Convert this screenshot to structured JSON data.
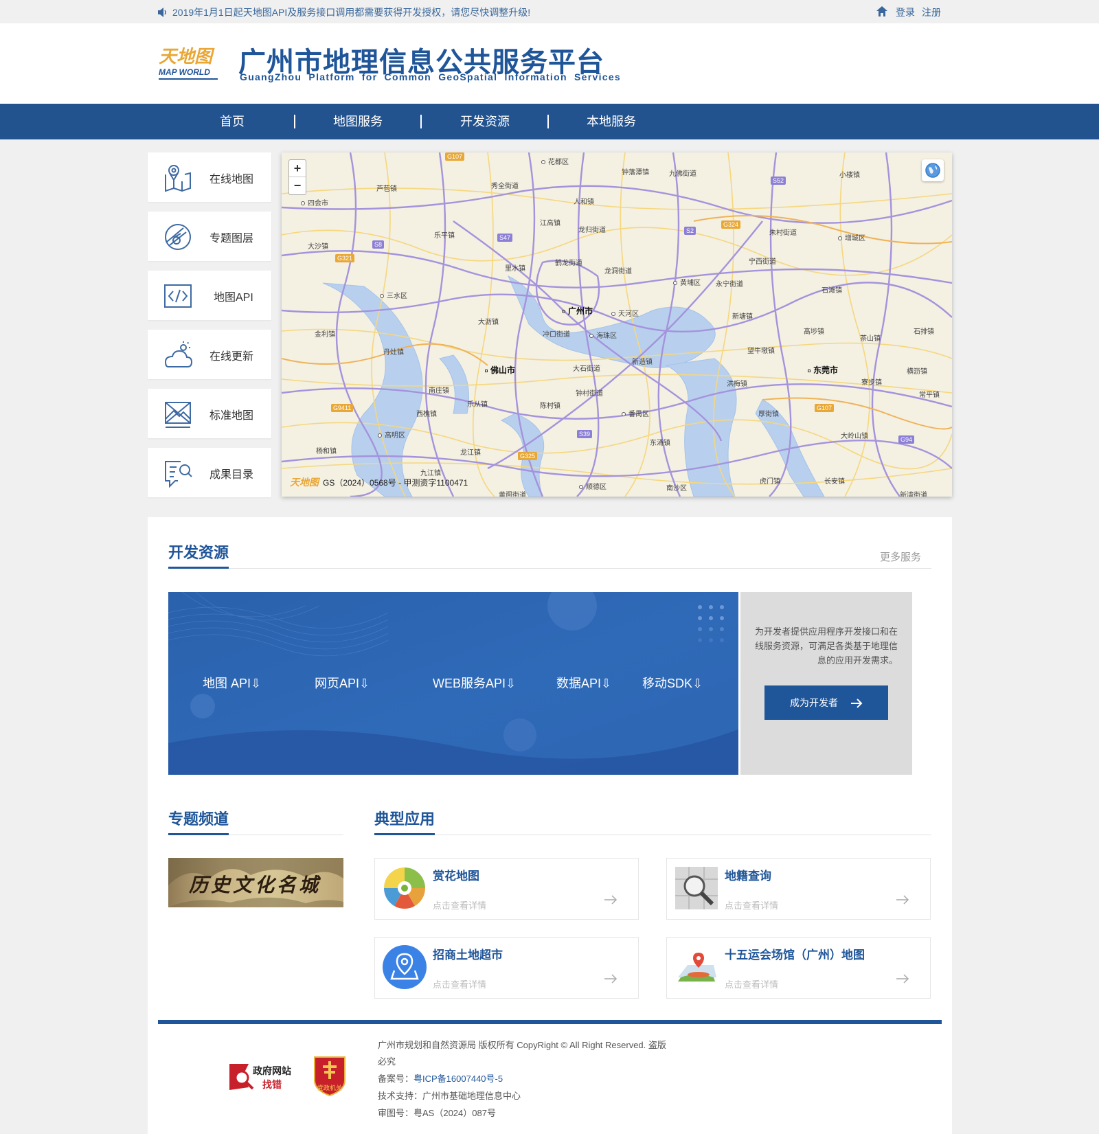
{
  "topbar": {
    "notice": "2019年1月1日起天地图API及服务接口调用都需要获得开发授权，请您尽快调整升级!",
    "login": "登录",
    "register": "注册"
  },
  "header": {
    "logo_text_top": "天地图",
    "logo_text_bottom": "MAP WORLD",
    "title": "广州市地理信息公共服务平台",
    "subtitle": "GuangZhou Platform for Common GeoSpatial Information Services"
  },
  "nav": {
    "items": [
      "首页",
      "地图服务",
      "开发资源",
      "本地服务"
    ]
  },
  "side_menu": {
    "items": [
      "在线地图",
      "专题图层",
      "地图API",
      "在线更新",
      "标准地图",
      "成果目录"
    ]
  },
  "map": {
    "zoom_in": "+",
    "zoom_out": "−",
    "credit_logo": "天地图",
    "credit": "GS（2024）0568号 - 甲测资字1100471",
    "labels": {
      "huadu": "花都区",
      "sihui": "四会市",
      "guangzhou": "广州市",
      "tianhe": "天河区",
      "haizhu": "海珠区",
      "huangpu": "黄埔区",
      "zengcheng": "增城区",
      "sanshui": "三水区",
      "foshan": "佛山市",
      "dongguan": "东莞市",
      "panyu": "番禺区",
      "gaoming": "高明区",
      "shunde": "顺德区",
      "nansha": "南沙区",
      "zhongluotan": "钟落潭镇",
      "jiufo": "九佛街道",
      "xiaolou": "小楼镇",
      "lubao": "芦苞镇",
      "xiuquan": "秀全街道",
      "renhe": "人和镇",
      "jianggao": "江高镇",
      "longgui": "龙归街道",
      "lepin": "乐平镇",
      "dasha": "大沙镇",
      "lishui": "里水镇",
      "helong": "鹤龙街道",
      "longdong": "龙洞街道",
      "ningxi": "宁西街道",
      "zhucun": "朱村街道",
      "yongning": "永宁街道",
      "shitan": "石滩镇",
      "xintang": "新塘镇",
      "gaobu": "高埗镇",
      "chashan": "茶山镇",
      "shipai": "石排镇",
      "dali": "大沥镇",
      "chongkou": "冲口街道",
      "jinli": "金利镇",
      "danzao": "丹灶镇",
      "dashi": "大石街道",
      "xinzao": "新造镇",
      "wangniudun": "望牛墩镇",
      "nanzhuang": "南庄镇",
      "zhongcun": "钟村街道",
      "hongmei": "洪梅镇",
      "liaobu": "寮步镇",
      "changping": "常平镇",
      "henglie": "横沥镇",
      "xiqiao": "西樵镇",
      "lecong": "乐从镇",
      "chencun": "陈村镇",
      "houjie": "厚街镇",
      "yanghe": "杨和镇",
      "longjiang": "龙江镇",
      "dongyong": "东涌镇",
      "dalingshan": "大岭山镇",
      "jiujiang": "九江镇",
      "humen": "虎门镇",
      "changan": "长安镇",
      "xinwan": "新湾街道",
      "huangge": "黄阁街道"
    },
    "roads": [
      "G107",
      "S52",
      "G324",
      "S47",
      "S8",
      "G321",
      "S2",
      "G107",
      "G9411",
      "S39",
      "G325",
      "G94"
    ]
  },
  "dev_section": {
    "title": "开发资源",
    "more": "更多服务",
    "links": [
      "地图 API⇩",
      "网页API⇩",
      "WEB服务API⇩",
      "数据API⇩",
      "移动SDK⇩"
    ],
    "description": "为开发者提供应用程序开发接口和在线服务资源，可满足各类基于地理信息的应用开发需求。",
    "button": "成为开发者"
  },
  "channel_section": {
    "title": "专题频道",
    "image_text": "历史文化名城"
  },
  "apps_section": {
    "title": "典型应用",
    "items": [
      {
        "name": "赏花地图",
        "detail": "点击查看详情"
      },
      {
        "name": "地籍查询",
        "detail": "点击查看详情"
      },
      {
        "name": "招商土地超市",
        "detail": "点击查看详情"
      },
      {
        "name": "十五运会场馆（广州）地图",
        "detail": "点击查看详情"
      }
    ]
  },
  "footer": {
    "gov_badge_line1": "政府网站",
    "gov_badge_line2": "找错",
    "party_badge": "党政机关",
    "line1": "广州市规划和自然资源局  版权所有   CopyRight © All Right Reserved. 盗版",
    "line1b": "必究",
    "icp_label": "备案号：",
    "icp_value": "粤ICP备16007440号-5",
    "support": "技术支持：广州市基础地理信息中心",
    "review": "审图号：粤AS（2024）087号"
  },
  "colors": {
    "brand": "#1f5599",
    "nav": "#23538f",
    "banner": "#2d66b2"
  }
}
